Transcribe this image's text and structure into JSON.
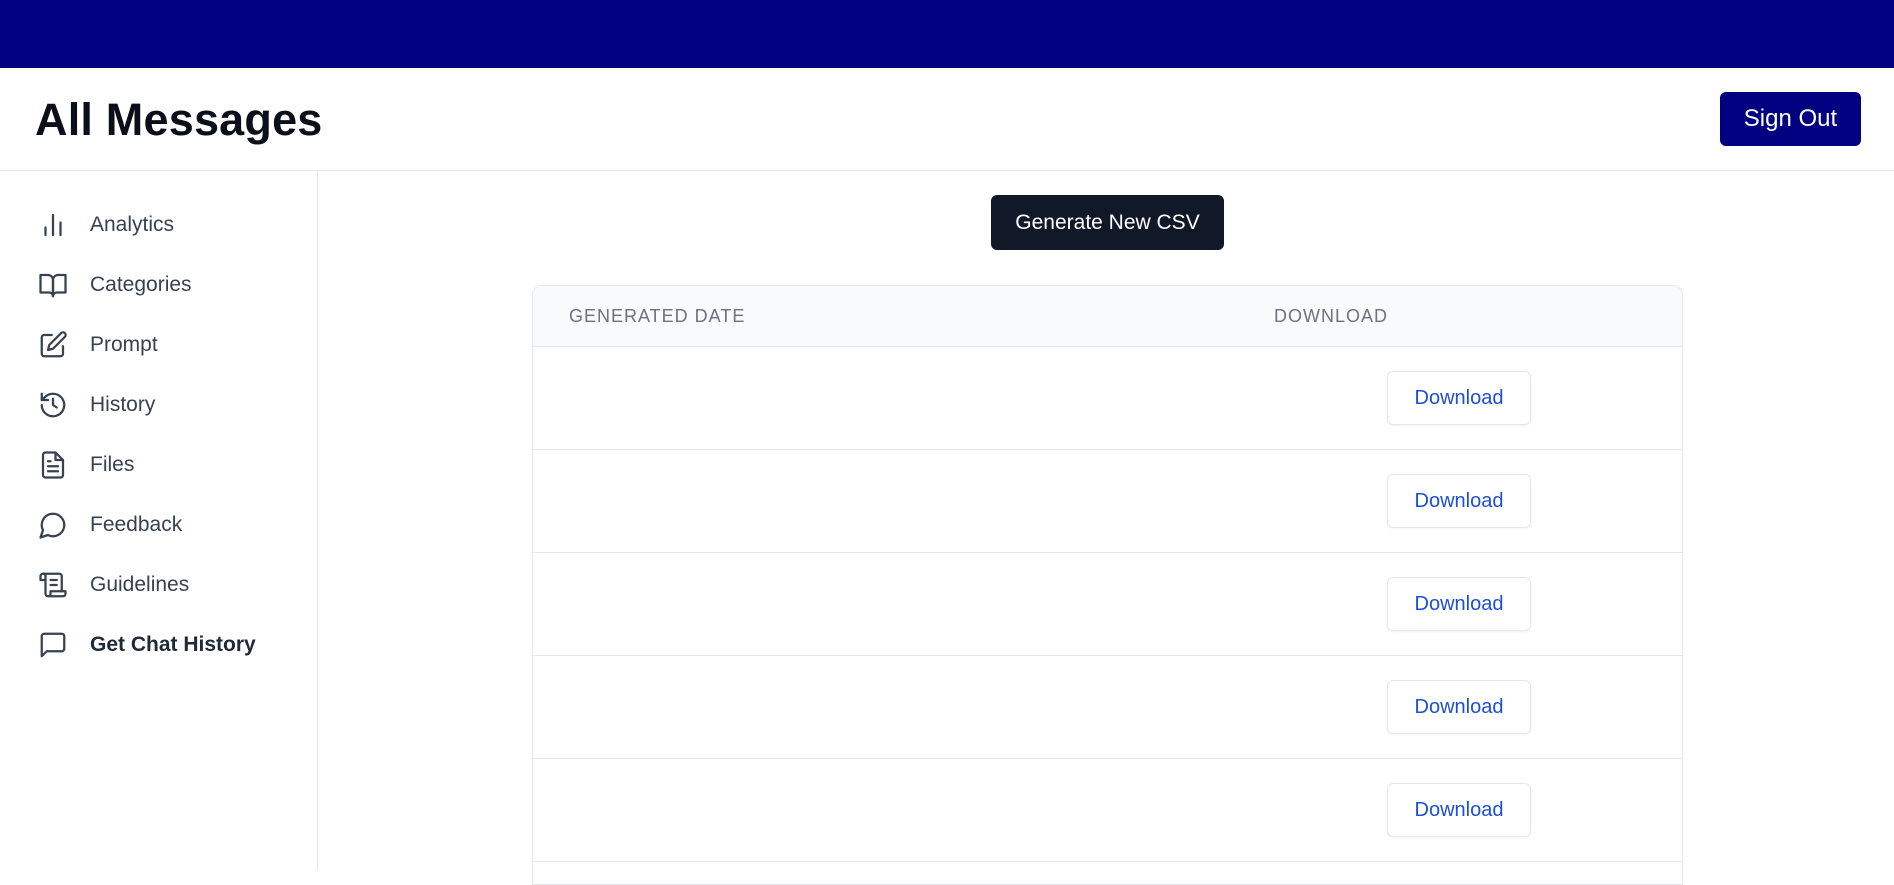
{
  "header": {
    "title": "All Messages",
    "sign_out_label": "Sign Out"
  },
  "colors": {
    "topbar": "#000080",
    "primary_dark": "#111827",
    "link": "#1d4ed8"
  },
  "sidebar": {
    "items": [
      {
        "label": "Analytics",
        "icon": "bar-chart-icon",
        "active": false
      },
      {
        "label": "Categories",
        "icon": "open-book-icon",
        "active": false
      },
      {
        "label": "Prompt",
        "icon": "edit-icon",
        "active": false
      },
      {
        "label": "History",
        "icon": "history-icon",
        "active": false
      },
      {
        "label": "Files",
        "icon": "file-text-icon",
        "active": false
      },
      {
        "label": "Feedback",
        "icon": "chat-bubble-icon",
        "active": false
      },
      {
        "label": "Guidelines",
        "icon": "scroll-icon",
        "active": false
      },
      {
        "label": "Get Chat History",
        "icon": "message-square-icon",
        "active": true
      }
    ]
  },
  "main": {
    "generate_label": "Generate New CSV",
    "table": {
      "columns": [
        "GENERATED DATE",
        "DOWNLOAD"
      ],
      "rows": [
        {
          "date": "",
          "action": "Download"
        },
        {
          "date": "",
          "action": "Download"
        },
        {
          "date": "",
          "action": "Download"
        },
        {
          "date": "",
          "action": "Download"
        },
        {
          "date": "",
          "action": "Download"
        }
      ]
    }
  }
}
